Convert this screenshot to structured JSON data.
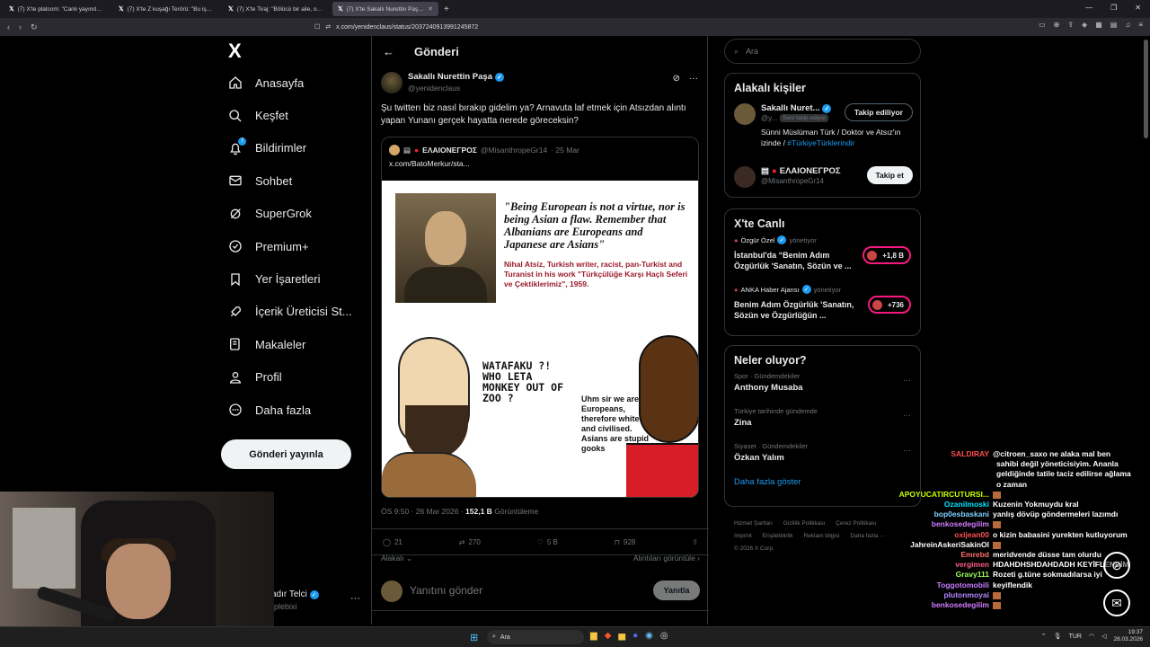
{
  "browser": {
    "tabs": [
      {
        "title": "(7) X'te platcom: \"Canlı yayında yönet...",
        "active": false
      },
      {
        "title": "(7) X'te Z kuşağı Terörü: \"Bu işgalci k...",
        "active": false
      },
      {
        "title": "(7) X'te Tiraj: \"Bölücü bir aile, oğulla...",
        "active": false
      },
      {
        "title": "(7) X'te Sakallı Nurettin Paşa: \"Şu...",
        "active": true
      }
    ],
    "url": "x.com/yenidenclaus/status/2037240913991245872"
  },
  "sidebar": {
    "logo": "X",
    "items": [
      {
        "label": "Anasayfa",
        "icon": "home-icon"
      },
      {
        "label": "Keşfet",
        "icon": "search-icon"
      },
      {
        "label": "Bildirimler",
        "icon": "bell-icon",
        "badge": "7"
      },
      {
        "label": "Sohbet",
        "icon": "mail-icon"
      },
      {
        "label": "SuperGrok",
        "icon": "grok-icon"
      },
      {
        "label": "Premium+",
        "icon": "premium-icon"
      },
      {
        "label": "Yer İşaretleri",
        "icon": "bookmark-icon"
      },
      {
        "label": "İçerik Üreticisi St...",
        "icon": "rocket-icon"
      },
      {
        "label": "Makaleler",
        "icon": "article-icon"
      },
      {
        "label": "Profil",
        "icon": "profile-icon"
      },
      {
        "label": "Daha fazla",
        "icon": "more-circle-icon"
      }
    ],
    "post_button": "Gönderi yayınla",
    "user_name": "adır Telci",
    "user_handle": "rplebixi"
  },
  "main": {
    "header_title": "Gönderi",
    "author_name": "Sakallı Nurettin Paşa",
    "author_handle": "@yenidenclaus",
    "text": "Şu twitterı biz nasıl bırakıp gidelim ya? Arnavuta laf etmek için Atsızdan alıntı yapan Yunanı gerçek hayatta nerede göreceksin?",
    "quote": {
      "name": "ΕΛΑΙΟΝΕΓΡΟΣ",
      "handle": "@MisanthropeGr14",
      "date": "· 25 Mar",
      "link": "x.com/BatoMerkur/sta..."
    },
    "meme": {
      "quote": "\"Being European is not a virtue, nor is being Asian a flaw. Remember that Albanians are Europeans and Japanese are Asians\"",
      "attribution": "Nihal Atsiz, Turkish writer, racist, pan-Turkist and Turanist in his work \"Türkçülüğe Karşı Haçlı Seferi ve Çektiklerimiz\", 1959.",
      "left_bubble": "WATAFAKU ?! WHO LETA MONKEY OUT OF ZOO ?",
      "right_bubble": "Uhm sir we are Europeans, therefore white and civilised. Asians are stupid gooks"
    },
    "meta_time": "ÖS 9:50 · 26 Mar 2026 ·",
    "meta_views": "152,1 B",
    "meta_views_label": "Görüntüleme",
    "engagement": {
      "replies": "21",
      "reposts": "270",
      "likes": "5 B",
      "bookmarks": "928"
    },
    "related_label": "Alakalı",
    "quotes_label": "Alıntıları görüntüle",
    "reply_placeholder": "Yanıtını gönder",
    "reply_button": "Yanıtla"
  },
  "right": {
    "search_placeholder": "Ara",
    "related_title": "Alakalı kişiler",
    "people": [
      {
        "name": "Sakallı Nuret...",
        "handle": "@y...",
        "follows_you": "Seni takip ediyor",
        "bio": "Sünni Müslüman Türk / Doktor ve Atsız'ın izinde / ",
        "bio_tag": "#TürkiyeTürklerindir",
        "button": "Takip ediliyor"
      },
      {
        "name": "ΕΛΑΙΟΝΕΓΡΟΣ",
        "handle": "@MisanthropeGr14",
        "button": "Takip et"
      }
    ],
    "live_title": "X'te Canlı",
    "live": [
      {
        "host": "Özgür Özel",
        "role": "yönetiyor",
        "title": "İstanbul'da “Benim Adım Özgürlük 'Sanatın, Sözün ve ...",
        "count": "+1,8 B"
      },
      {
        "host": "ANKA Haber Ajansı",
        "role": "yönetiyor",
        "title": "Benim Adım Özgürlük 'Sanatın, Sözün ve Özgürlüğün ...",
        "count": "+736"
      }
    ],
    "trends_title": "Neler oluyor?",
    "trends": [
      {
        "category": "Spor · Gündemdekiler",
        "name": "Anthony Musaba"
      },
      {
        "category": "Türkiye tarihinde gündemde",
        "name": "Zina"
      },
      {
        "category": "Siyaset · Gündemdekiler",
        "name": "Özkan Yalım"
      }
    ],
    "show_more": "Daha fazla göster",
    "footer": [
      "Hizmet Şartları",
      "Gizlilik Politikası",
      "Çerez Politikası",
      "Imprint",
      "Erişilebilirlik",
      "Reklam bilgisi",
      "Daha fazla ···",
      "© 2026 X Corp."
    ]
  },
  "chat": [
    {
      "user": "SALDIRAY",
      "color": "#ff4d4d",
      "msg": "@citroen_saxo ne alaka mal ben"
    },
    {
      "wrap": "sahibi değil yöneticisiyim. Ananla"
    },
    {
      "wrap": "geldiğinde tatile taciz edilirse ağlama"
    },
    {
      "wrap": "o zaman"
    },
    {
      "user": "APOYUCATIRCUTURSI...",
      "color": "#c6ff00",
      "msg": ""
    },
    {
      "user": "Ozanilmoski",
      "color": "#00e5ff",
      "msg": "Kuzenin Yokmuydu kral"
    },
    {
      "user": "bop0esbaskani",
      "color": "#7cd3ff",
      "msg": "yanlış dövüp göndermeleri lazımdı"
    },
    {
      "user": "benkosedegilim",
      "color": "#d27cff",
      "msg": ""
    },
    {
      "user": "oxijean00",
      "color": "#ff5252",
      "msg": "o kizin babasini yurekten kutluyorum"
    },
    {
      "user": "JahreinAskeriSakinOl",
      "color": "#ffffff",
      "msg": ""
    },
    {
      "user": "Emrebd",
      "color": "#ff6e6e",
      "msg": "meridvende düsse tam olurdu"
    },
    {
      "user": "vergimen",
      "color": "#ff5c8a",
      "msg": "HDAHDHSHDAHDADH KEYİFLENDİM"
    },
    {
      "user": "Gravy111",
      "color": "#9cff57",
      "msg": "Rozeti g.tüne sokmadılarsa iyi"
    },
    {
      "user": "Toggotomobili",
      "color": "#c77dff",
      "msg": "keyiflendik"
    },
    {
      "user": "plutonmoyai",
      "color": "#b388ff",
      "msg": ""
    },
    {
      "user": "benkosedegilim",
      "color": "#d27cff",
      "msg": ""
    }
  ],
  "taskbar": {
    "search": "Ara",
    "lang": "TUR",
    "time": "19:37",
    "date": "28.03.2026"
  },
  "colors": {
    "accent": "#1d9bf0",
    "background": "#000000",
    "border": "#2f3336",
    "muted": "#71767b"
  }
}
